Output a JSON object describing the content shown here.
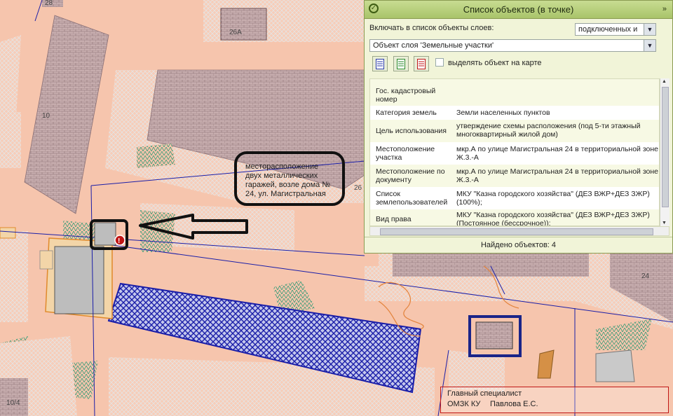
{
  "map": {
    "building_labels": [
      "28",
      "26А",
      "10",
      "26",
      "24",
      "10/4"
    ],
    "callout_text": "месторасположение двух металлических гаражей, возле дома № 24, ул. Магистральная"
  },
  "panel": {
    "title": "Список объектов (в точке)",
    "collapse_icon": "»",
    "include_label": "Включать в список объекты слоев:",
    "layers_select": "подключенных и",
    "layer_object_select": "Объект слоя 'Земельные участки'",
    "highlight_label": "выделять объект на карте",
    "highlight_checked": false,
    "export_icons": [
      "doc-blue-icon",
      "doc-green-icon",
      "doc-red-icon"
    ],
    "rows": [
      {
        "key": "Гос. кадастровый номер",
        "value": ""
      },
      {
        "key": "Категория земель",
        "value": "Земли населенных пунктов"
      },
      {
        "key": "Цель использования",
        "value": "утверждение схемы расположения (под 5-ти этажный многоквартирный жилой дом)"
      },
      {
        "key": "Местоположение участка",
        "value": "мкр.А по улице Магистральная 24 в территориальной зоне Ж.3.-А"
      },
      {
        "key": "Местоположение по документу",
        "value": "мкр.А по улице Магистральная 24 в территориальной зоне Ж.3.-А"
      },
      {
        "key": "Список землепользователей",
        "value": "МКУ \"Казна городского хозяйства\" (ДЕЗ ВЖР+ДЕЗ ЗЖР) (100%);"
      },
      {
        "key": "Вид права",
        "value": "МКУ \"Казна городского хозяйства\" (ДЕЗ ВЖР+ДЕЗ ЗЖР) (Постоянное (бессрочное));"
      }
    ],
    "found_text": "Найдено объектов: 4",
    "colors": {
      "header": "#a9c46a",
      "alt_row": "#f7f9e4"
    }
  },
  "signature": {
    "position": "Главный специалист",
    "department": "ОМЗК КУ",
    "name": "Павлова Е.С."
  }
}
